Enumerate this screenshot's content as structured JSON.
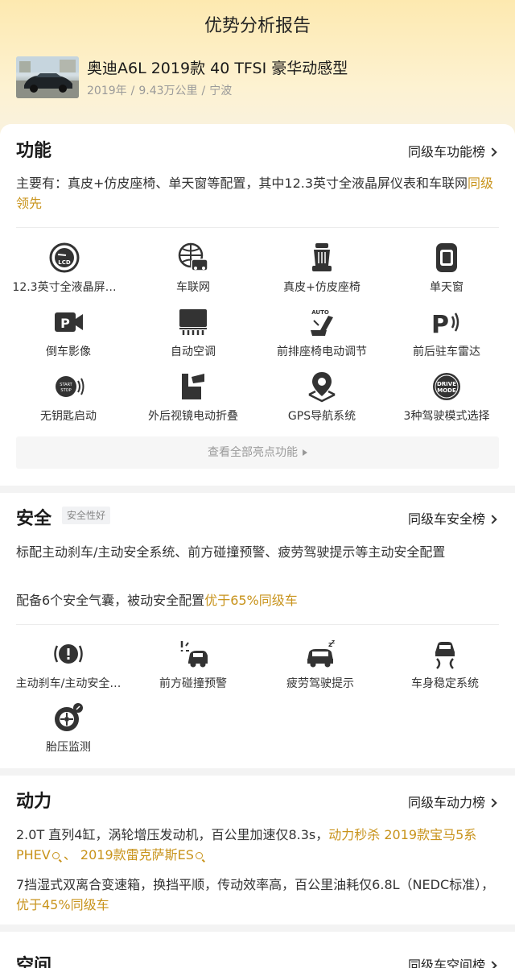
{
  "page": {
    "title": "优势分析报告"
  },
  "car": {
    "name": "奥迪A6L 2019款 40 TFSI 豪华动感型",
    "year": "2019年",
    "mileage": "9.43万公里",
    "city": "宁波",
    "sep": "/"
  },
  "function": {
    "title": "功能",
    "rank_link": "同级车功能榜",
    "summary_main": "主要有：真皮+仿皮座椅、单天窗等配置，其中12.3英寸全液晶屏仪表和车联网",
    "summary_hl": "同级领先",
    "features": [
      {
        "label": "12.3英寸全液晶屏…",
        "icon": "lcd-gauge-icon"
      },
      {
        "label": "车联网",
        "icon": "connected-car-icon"
      },
      {
        "label": "真皮+仿皮座椅",
        "icon": "leather-seat-icon"
      },
      {
        "label": "单天窗",
        "icon": "sunroof-icon"
      },
      {
        "label": "倒车影像",
        "icon": "reverse-camera-icon"
      },
      {
        "label": "自动空调",
        "icon": "auto-ac-icon"
      },
      {
        "label": "前排座椅电动调节",
        "icon": "power-seat-icon"
      },
      {
        "label": "前后驻车雷达",
        "icon": "parking-radar-icon"
      },
      {
        "label": "无钥匙启动",
        "icon": "keyless-start-icon"
      },
      {
        "label": "外后视镜电动折叠",
        "icon": "mirror-fold-icon"
      },
      {
        "label": "GPS导航系统",
        "icon": "gps-icon"
      },
      {
        "label": "3种驾驶模式选择",
        "icon": "drive-mode-icon"
      }
    ],
    "more": "查看全部亮点功能",
    "icon_text": {
      "lcd": "LCD",
      "auto": "AUTO",
      "start": "START",
      "stop": "STOP",
      "drive": "DRIVE",
      "mode": "MODE"
    }
  },
  "safety": {
    "title": "安全",
    "tag": "安全性好",
    "rank_link": "同级车安全榜",
    "line1": "标配主动刹车/主动安全系统、前方碰撞预警、疲劳驾驶提示等主动安全配置",
    "line2_main": "配备6个安全气囊，被动安全配置",
    "line2_hl": "优于65%同级车",
    "features": [
      {
        "label": "主动刹车/主动安全…",
        "icon": "active-brake-icon"
      },
      {
        "label": "前方碰撞预警",
        "icon": "collision-warning-icon"
      },
      {
        "label": "疲劳驾驶提示",
        "icon": "fatigue-alert-icon"
      },
      {
        "label": "车身稳定系统",
        "icon": "stability-control-icon"
      },
      {
        "label": "胎压监测",
        "icon": "tire-pressure-icon"
      }
    ]
  },
  "power": {
    "title": "动力",
    "rank_link": "同级车动力榜",
    "line1_main": "2.0T 直列4缸，涡轮增压发动机，百公里加速仅8.3s，",
    "line1_hl": "动力秒杀 2019款宝马5系PHEV",
    "line1_sep": " 、 ",
    "line1_hl2": "2019款雷克萨斯ES",
    "line2_main": "7挡湿式双离合变速箱，换挡平顺，传动效率高，百公里油耗仅6.8L（NEDC标准），",
    "line2_hl": "优于45%同级车"
  },
  "space": {
    "title": "空间",
    "rank_link": "同级车空间榜"
  },
  "colors": {
    "accent": "#c8931b",
    "icon": "#333333",
    "header_bg": "#fde9b0"
  }
}
